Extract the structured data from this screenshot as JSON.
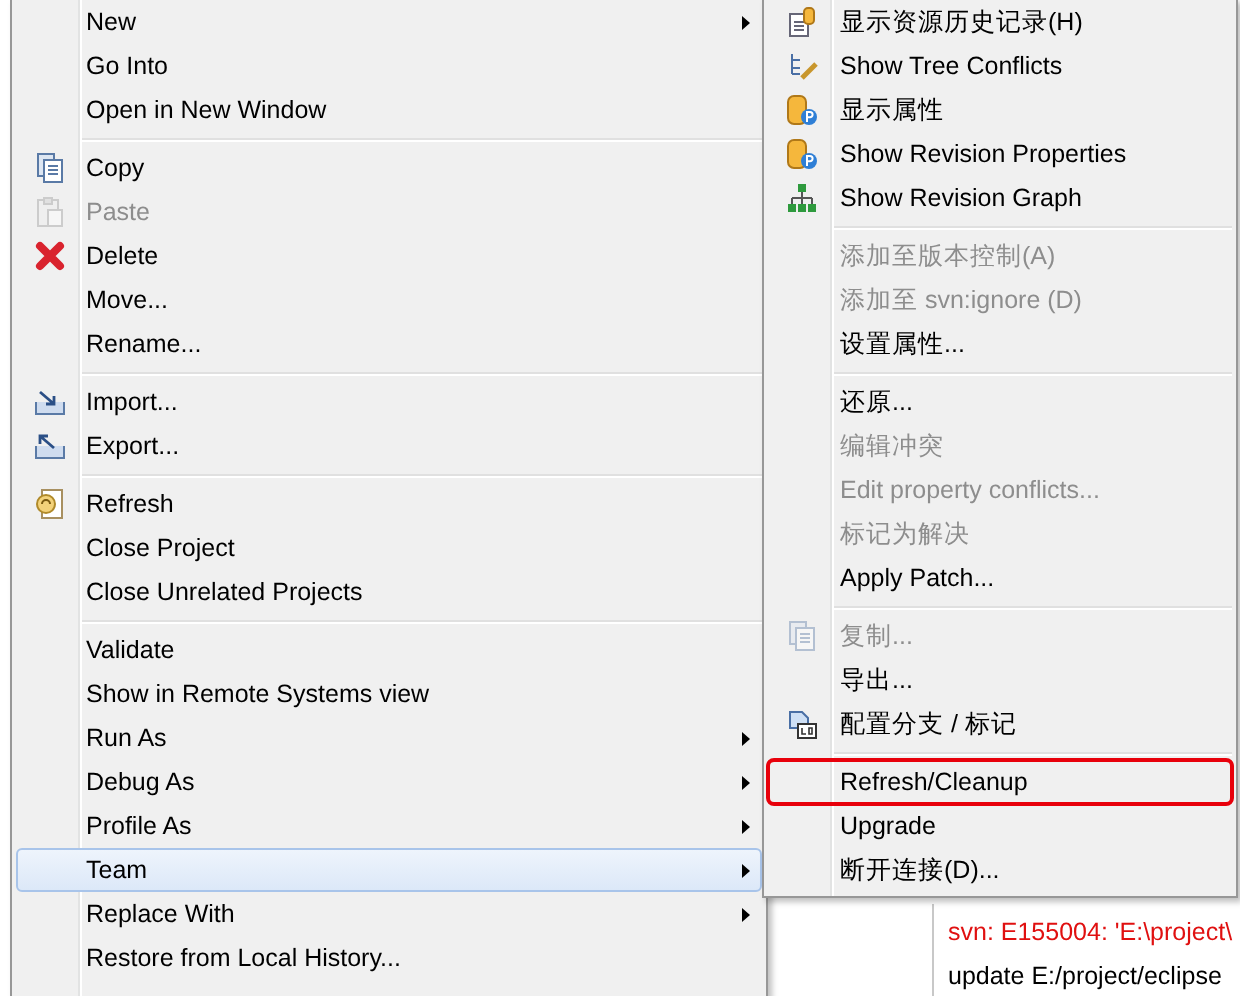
{
  "context_menu": {
    "items": [
      {
        "kind": "item",
        "label": "New",
        "submenu": true
      },
      {
        "kind": "item",
        "label": "Go Into"
      },
      {
        "kind": "item",
        "label": "Open in New Window"
      },
      {
        "kind": "separator"
      },
      {
        "kind": "item",
        "label": "Copy"
      },
      {
        "kind": "item",
        "label": "Paste",
        "disabled": true
      },
      {
        "kind": "item",
        "label": "Delete"
      },
      {
        "kind": "item",
        "label": "Move..."
      },
      {
        "kind": "item",
        "label": "Rename..."
      },
      {
        "kind": "separator"
      },
      {
        "kind": "item",
        "label": "Import..."
      },
      {
        "kind": "item",
        "label": "Export..."
      },
      {
        "kind": "separator"
      },
      {
        "kind": "item",
        "label": "Refresh"
      },
      {
        "kind": "item",
        "label": "Close Project"
      },
      {
        "kind": "item",
        "label": "Close Unrelated Projects"
      },
      {
        "kind": "separator"
      },
      {
        "kind": "item",
        "label": "Validate"
      },
      {
        "kind": "item",
        "label": "Show in Remote Systems view"
      },
      {
        "kind": "item",
        "label": "Run As",
        "submenu": true
      },
      {
        "kind": "item",
        "label": "Debug As",
        "submenu": true
      },
      {
        "kind": "item",
        "label": "Profile As",
        "submenu": true
      },
      {
        "kind": "item",
        "label": "Team",
        "submenu": true,
        "selected": true
      },
      {
        "kind": "item",
        "label": "Replace With",
        "submenu": true
      },
      {
        "kind": "item",
        "label": "Restore from Local History..."
      }
    ]
  },
  "team_submenu": {
    "items": [
      {
        "kind": "item",
        "label": "显示资源历史记录(H)"
      },
      {
        "kind": "item",
        "label": "Show Tree Conflicts"
      },
      {
        "kind": "item",
        "label": "显示属性"
      },
      {
        "kind": "item",
        "label": "Show Revision Properties"
      },
      {
        "kind": "item",
        "label": "Show Revision Graph"
      },
      {
        "kind": "separator"
      },
      {
        "kind": "item",
        "label": "添加至版本控制(A)",
        "disabled": true
      },
      {
        "kind": "item",
        "label": "添加至 svn:ignore (D)",
        "disabled": true
      },
      {
        "kind": "item",
        "label": "设置属性..."
      },
      {
        "kind": "separator"
      },
      {
        "kind": "item",
        "label": "还原..."
      },
      {
        "kind": "item",
        "label": "编辑冲突",
        "disabled": true
      },
      {
        "kind": "item",
        "label": "Edit property conflicts...",
        "disabled": true
      },
      {
        "kind": "item",
        "label": "标记为解决",
        "disabled": true
      },
      {
        "kind": "item",
        "label": "Apply Patch..."
      },
      {
        "kind": "separator"
      },
      {
        "kind": "item",
        "label": "复制...",
        "disabled": true
      },
      {
        "kind": "item",
        "label": "导出..."
      },
      {
        "kind": "item",
        "label": "配置分支 / 标记"
      },
      {
        "kind": "separator"
      },
      {
        "kind": "item",
        "label": "Refresh/Cleanup",
        "highlighted": true
      },
      {
        "kind": "item",
        "label": "Upgrade"
      },
      {
        "kind": "item",
        "label": "断开连接(D)..."
      }
    ]
  },
  "console": {
    "lines": [
      {
        "kind": "error",
        "text": "svn: E155004: 'E:\\project\\"
      },
      {
        "kind": "normal",
        "text": "update E:/project/eclipse"
      }
    ]
  }
}
